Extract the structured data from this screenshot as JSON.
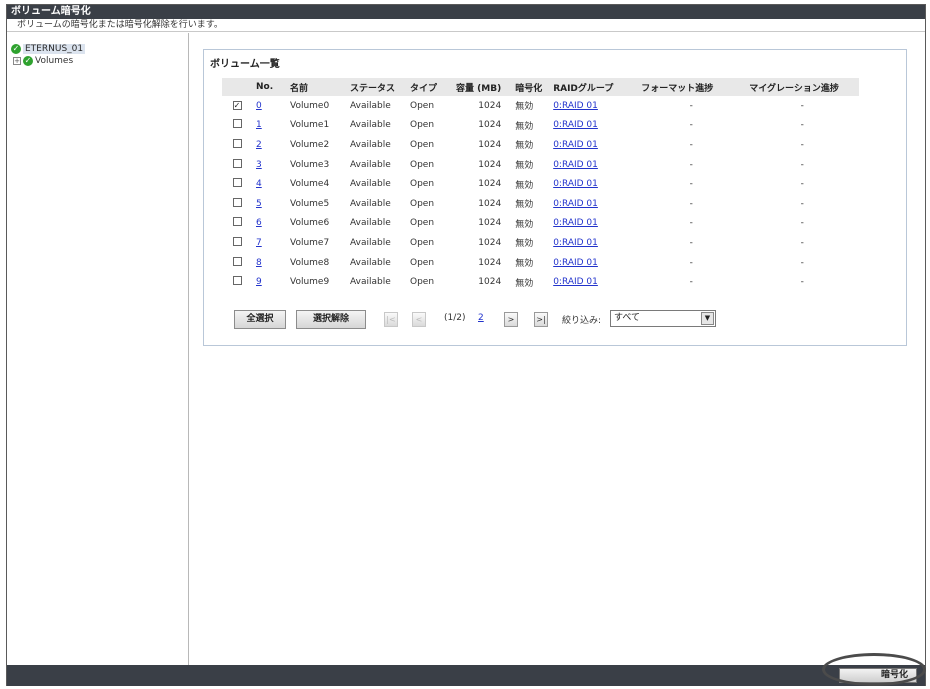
{
  "header": {
    "title": "ボリューム暗号化",
    "subtitle": "ボリュームの暗号化または暗号化解除を行います。"
  },
  "tree": {
    "root_label": "ETERNUS_01",
    "child_label": "Volumes",
    "expander": "+",
    "status_icon": "check-circle-icon"
  },
  "panel": {
    "title": "ボリューム一覧"
  },
  "table": {
    "columns": {
      "no": "No.",
      "name": "名前",
      "status": "ステータス",
      "type": "タイプ",
      "capacity": "容量 (MB)",
      "encryption": "暗号化",
      "raid": "RAIDグループ",
      "format": "フォーマット進捗",
      "migration": "マイグレーション進捗"
    },
    "rows": [
      {
        "checked": "✓",
        "no": "0",
        "name": "Volume0",
        "status": "Available",
        "type": "Open",
        "capacity": "1024",
        "encryption": "無効",
        "raid": "0:RAID 01",
        "format": "-",
        "migration": "-"
      },
      {
        "checked": "",
        "no": "1",
        "name": "Volume1",
        "status": "Available",
        "type": "Open",
        "capacity": "1024",
        "encryption": "無効",
        "raid": "0:RAID 01",
        "format": "-",
        "migration": "-"
      },
      {
        "checked": "",
        "no": "2",
        "name": "Volume2",
        "status": "Available",
        "type": "Open",
        "capacity": "1024",
        "encryption": "無効",
        "raid": "0:RAID 01",
        "format": "-",
        "migration": "-"
      },
      {
        "checked": "",
        "no": "3",
        "name": "Volume3",
        "status": "Available",
        "type": "Open",
        "capacity": "1024",
        "encryption": "無効",
        "raid": "0:RAID 01",
        "format": "-",
        "migration": "-"
      },
      {
        "checked": "",
        "no": "4",
        "name": "Volume4",
        "status": "Available",
        "type": "Open",
        "capacity": "1024",
        "encryption": "無効",
        "raid": "0:RAID 01",
        "format": "-",
        "migration": "-"
      },
      {
        "checked": "",
        "no": "5",
        "name": "Volume5",
        "status": "Available",
        "type": "Open",
        "capacity": "1024",
        "encryption": "無効",
        "raid": "0:RAID 01",
        "format": "-",
        "migration": "-"
      },
      {
        "checked": "",
        "no": "6",
        "name": "Volume6",
        "status": "Available",
        "type": "Open",
        "capacity": "1024",
        "encryption": "無効",
        "raid": "0:RAID 01",
        "format": "-",
        "migration": "-"
      },
      {
        "checked": "",
        "no": "7",
        "name": "Volume7",
        "status": "Available",
        "type": "Open",
        "capacity": "1024",
        "encryption": "無効",
        "raid": "0:RAID 01",
        "format": "-",
        "migration": "-"
      },
      {
        "checked": "",
        "no": "8",
        "name": "Volume8",
        "status": "Available",
        "type": "Open",
        "capacity": "1024",
        "encryption": "無効",
        "raid": "0:RAID 01",
        "format": "-",
        "migration": "-"
      },
      {
        "checked": "",
        "no": "9",
        "name": "Volume9",
        "status": "Available",
        "type": "Open",
        "capacity": "1024",
        "encryption": "無効",
        "raid": "0:RAID 01",
        "format": "-",
        "migration": "-"
      }
    ]
  },
  "controls": {
    "select_all": "全選択",
    "deselect_all": "選択解除",
    "first": "|<",
    "prev": "<",
    "page_indicator": "(1/2)",
    "page_link": "2",
    "next": ">",
    "last": ">|",
    "filter_label": "絞り込み:",
    "filter_value": "すべて",
    "filter_arrow": "▼"
  },
  "footer": {
    "encrypt_button": "暗号化"
  },
  "colors": {
    "titlebar": "#3a3f47",
    "link": "#2233cc",
    "status_ok": "#2fa22f"
  }
}
